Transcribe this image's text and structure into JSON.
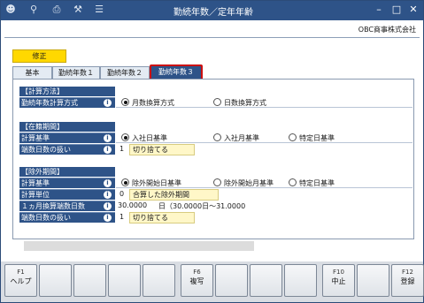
{
  "window": {
    "title": "勤続年数／定年年齢",
    "company": "OBC商事株式会社"
  },
  "toolbar": {
    "icons": [
      "user-add-icon",
      "search-icon",
      "print-icon",
      "tools-icon",
      "list-icon"
    ],
    "window_controls": [
      "minimize-icon",
      "maximize-icon",
      "close-icon"
    ]
  },
  "mode": "修正",
  "tabs": [
    {
      "label": "基本",
      "active": false
    },
    {
      "label": "勤続年数１",
      "active": false
    },
    {
      "label": "勤続年数２",
      "active": false
    },
    {
      "label": "勤続年数３",
      "active": true
    }
  ],
  "calc_method": {
    "section": "【計算方法】",
    "label": "勤続年数計算方式",
    "options": [
      "月数換算方式",
      "日数換算方式"
    ],
    "selected": 0
  },
  "tenure": {
    "section": "【在籍期間】",
    "basis_label": "計算基準",
    "basis_options": [
      "入社日基準",
      "入社月基準",
      "特定日基準"
    ],
    "basis_selected": 0,
    "fraction_label": "端数日数の扱い",
    "fraction_num": "1",
    "fraction_value": "切り捨てる"
  },
  "exclusion": {
    "section": "【除外期間】",
    "basis_label": "計算基準",
    "basis_options": [
      "除外開始日基準",
      "除外開始月基準",
      "特定日基準"
    ],
    "basis_selected": 0,
    "unit_label": "計算単位",
    "unit_num": "0",
    "unit_value": "合算した除外期間",
    "days_label": "１ヵ月換算端数日数",
    "days_value": "30.0000",
    "days_note": "日（30.0000日〜31.0000日）",
    "fraction_label": "端数日数の扱い",
    "fraction_num": "1",
    "fraction_value": "切り捨てる"
  },
  "fkeys": [
    {
      "key": "F1",
      "label": "ヘルプ"
    },
    {
      "key": "",
      "label": ""
    },
    {
      "key": "",
      "label": ""
    },
    {
      "key": "",
      "label": ""
    },
    {
      "key": "",
      "label": ""
    },
    {
      "key": "F6",
      "label": "複写"
    },
    {
      "key": "",
      "label": ""
    },
    {
      "key": "",
      "label": ""
    },
    {
      "key": "",
      "label": ""
    },
    {
      "key": "F10",
      "label": "中止"
    },
    {
      "key": "",
      "label": ""
    },
    {
      "key": "F12",
      "label": "登録"
    }
  ]
}
